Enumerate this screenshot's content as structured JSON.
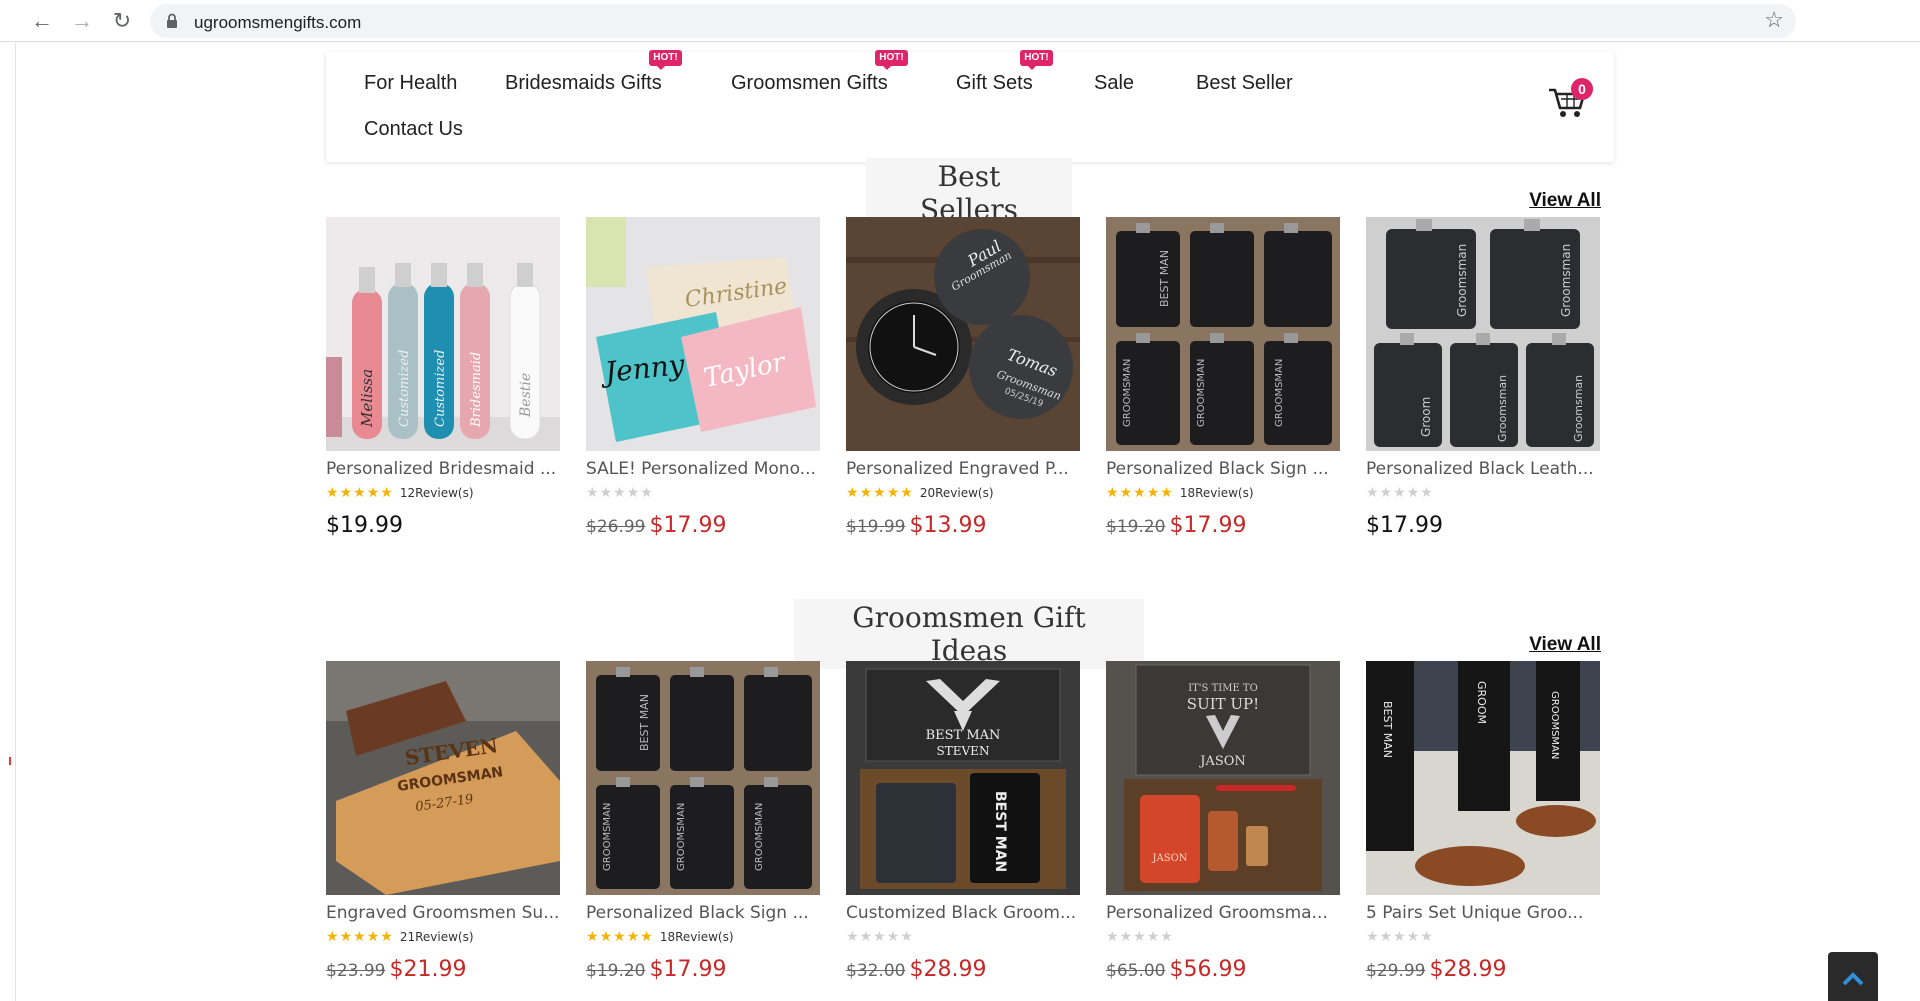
{
  "browser": {
    "url": "ugroomsmengifts.com"
  },
  "menu": {
    "items": [
      {
        "label": "For Health",
        "hot": false
      },
      {
        "label": "Bridesmaids Gifts",
        "hot": true
      },
      {
        "label": "Groomsmen Gifts",
        "hot": true
      },
      {
        "label": "Gift Sets",
        "hot": true
      },
      {
        "label": "Sale",
        "hot": false
      },
      {
        "label": "Best Seller",
        "hot": false
      },
      {
        "label": "Contact Us",
        "hot": false
      }
    ],
    "hot_badge": "HOT!",
    "cart_count": "0"
  },
  "sections": [
    {
      "title": "Best Sellers",
      "view_all": "View All",
      "products": [
        {
          "name": "Personalized Bridesmaid ...",
          "stars": 5,
          "reviews": "12Review(s)",
          "old_price": "",
          "price": "$19.99"
        },
        {
          "name": "SALE! Personalized Mono...",
          "stars": 0,
          "reviews": "",
          "old_price": "$26.99",
          "price": "$17.99"
        },
        {
          "name": "Personalized Engraved P...",
          "stars": 5,
          "reviews": "20Review(s)",
          "old_price": "$19.99",
          "price": "$13.99"
        },
        {
          "name": "Personalized Black Sign ...",
          "stars": 5,
          "reviews": "18Review(s)",
          "old_price": "$19.20",
          "price": "$17.99"
        },
        {
          "name": "Personalized Black Leath...",
          "stars": 0,
          "reviews": "",
          "old_price": "",
          "price": "$17.99"
        }
      ]
    },
    {
      "title": "Groomsmen Gift Ideas",
      "view_all": "View All",
      "products": [
        {
          "name": "Engraved Groomsmen Su...",
          "stars": 5,
          "reviews": "21Review(s)",
          "old_price": "$23.99",
          "price": "$21.99"
        },
        {
          "name": "Personalized Black Sign ...",
          "stars": 5,
          "reviews": "18Review(s)",
          "old_price": "$19.20",
          "price": "$17.99"
        },
        {
          "name": "Customized Black Groom...",
          "stars": 0,
          "reviews": "",
          "old_price": "$32.00",
          "price": "$28.99"
        },
        {
          "name": "Personalized Groomsma...",
          "stars": 0,
          "reviews": "",
          "old_price": "$65.00",
          "price": "$56.99"
        },
        {
          "name": "5 Pairs Set Unique Groo...",
          "stars": 0,
          "reviews": "",
          "old_price": "$29.99",
          "price": "$28.99"
        }
      ]
    }
  ],
  "image_text": {
    "bottles": [
      "Melissa",
      "Customized",
      "Customized",
      "Bridesmaid",
      "Bestie"
    ],
    "pouches": [
      "Christine",
      "Jenny",
      "Taylor"
    ],
    "watch": [
      "Paul",
      "Groomsman",
      "Tomas",
      "Groomsman",
      "05/25/19"
    ],
    "sunglasses": [
      "STEVEN",
      "GROOMSMAN",
      "05-27-19"
    ],
    "box_best_man": [
      "BEST MAN",
      "STEVEN",
      "BEST MAN"
    ],
    "suitup": [
      "IT'S TIME TO",
      "SUIT UP!",
      "JASON",
      "JASON"
    ]
  },
  "colors": {
    "accent_red": "#c62828",
    "hot_badge": "#e0246a",
    "star": "#f5b301"
  }
}
